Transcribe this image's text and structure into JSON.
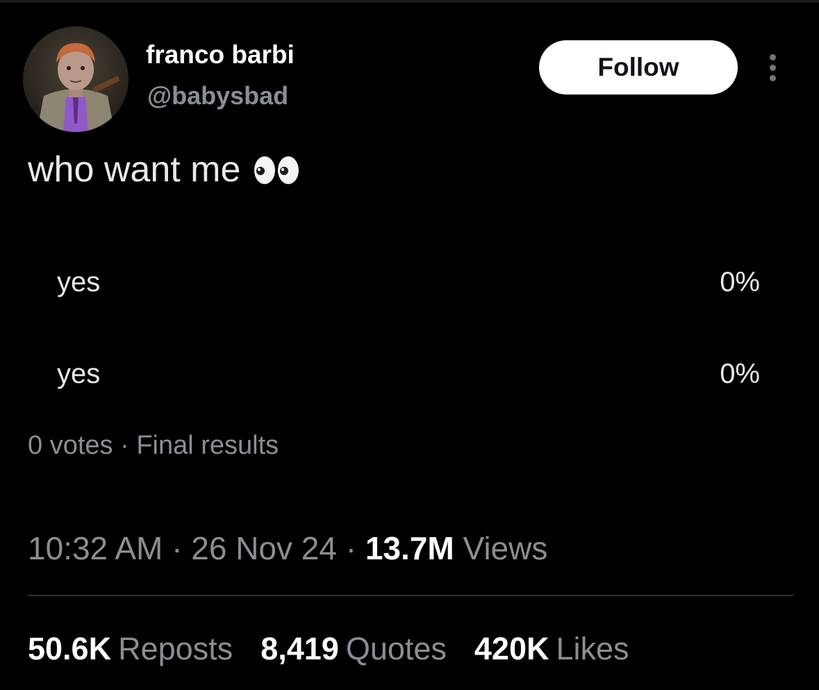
{
  "author": {
    "display_name": "franco barbi",
    "handle": "@babysbad",
    "avatar_icon": "avatar-image"
  },
  "actions": {
    "follow_label": "Follow",
    "more_icon": "more-vertical-icon"
  },
  "tweet": {
    "text": "who want me",
    "emoji_icon": "eyes-emoji-icon"
  },
  "poll": {
    "options": [
      {
        "label": "yes",
        "percent": "0%"
      },
      {
        "label": "yes",
        "percent": "0%"
      }
    ],
    "votes": "0 votes",
    "separator": "·",
    "status": "Final results"
  },
  "meta": {
    "time": "10:32 AM",
    "separator": "·",
    "date": "26 Nov 24",
    "views_count": "13.7M",
    "views_label": "Views"
  },
  "stats": {
    "reposts_count": "50.6K",
    "reposts_label": "Reposts",
    "quotes_count": "8,419",
    "quotes_label": "Quotes",
    "likes_count": "420K",
    "likes_label": "Likes"
  },
  "colors": {
    "background": "#000000",
    "text_primary": "#e7e9ea",
    "text_secondary": "#8a8f95",
    "divider": "#2f3336",
    "button_bg": "#ffffff"
  }
}
